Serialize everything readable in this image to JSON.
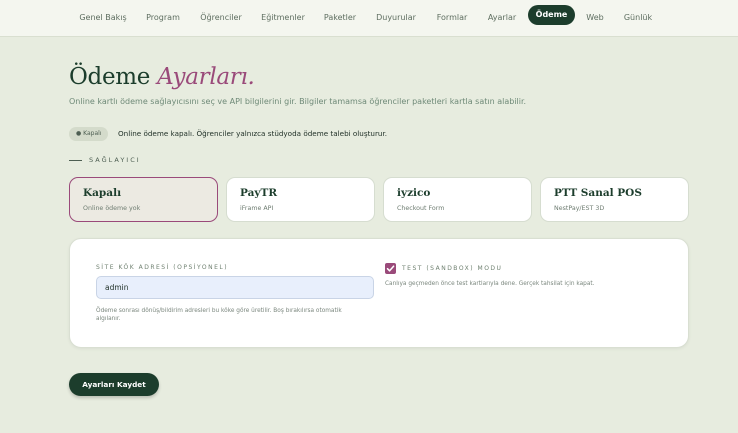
{
  "nav": {
    "items": [
      {
        "label": "Genel Bakış"
      },
      {
        "label": "Program"
      },
      {
        "label": "Öğrenciler"
      },
      {
        "label": "Eğitmenler"
      },
      {
        "label": "Paketler"
      },
      {
        "label": "Duyurular"
      },
      {
        "label": "Formlar"
      },
      {
        "label": "Ayarlar"
      },
      {
        "label": "Ödeme",
        "active": true
      },
      {
        "label": "Web"
      },
      {
        "label": "Günlük"
      }
    ]
  },
  "header": {
    "title_plain": "Ödeme",
    "title_accent": "Ayarları.",
    "subtitle": "Online kartlı ödeme sağlayıcısını seç ve API bilgilerini gir. Bilgiler tamamsa öğrenciler paketleri kartla satın alabilir."
  },
  "status": {
    "badge": "● Kapalı",
    "text": "Online ödeme kapalı. Öğrenciler yalnızca stüdyoda ödeme talebi oluşturur."
  },
  "section": {
    "label": "SAĞLAYICI"
  },
  "providers": [
    {
      "name": "Kapalı",
      "desc": "Online ödeme yok",
      "selected": true
    },
    {
      "name": "PayTR",
      "desc": "iFrame API"
    },
    {
      "name": "iyzico",
      "desc": "Checkout Form"
    },
    {
      "name": "PTT Sanal POS",
      "desc": "NestPay/EST 3D"
    }
  ],
  "settings": {
    "site_label": "SİTE KÖK ADRESİ (OPSİYONEL)",
    "site_value": "admin",
    "site_help": "Ödeme sonrası dönüş/bildirim adresleri bu köke göre üretilir. Boş bırakılırsa otomatik algılanır.",
    "test_mode_checked": true,
    "test_label": "TEST (SANDBOX) MODU",
    "test_help": "Canlıya geçmeden önce test kartlarıyla dene. Gerçek tahsilat için kapat."
  },
  "actions": {
    "save_label": "Ayarları Kaydet"
  },
  "colors": {
    "primary": "#1c3d2c",
    "accent": "#9a4a7a",
    "background": "#e7ecdf"
  }
}
